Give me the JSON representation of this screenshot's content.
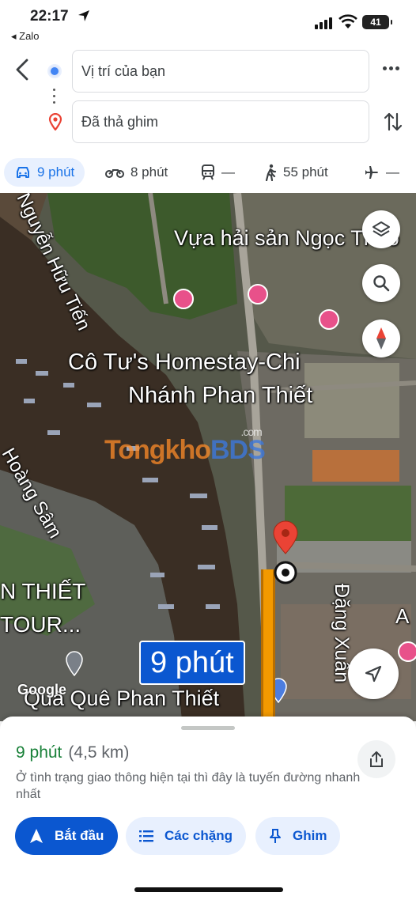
{
  "status_bar": {
    "time": "22:17",
    "back_app": "◂ Zalo",
    "battery": "41"
  },
  "route": {
    "origin_label": "Vị trí của bạn",
    "destination_label": "Đã thả ghim"
  },
  "modes": [
    {
      "icon": "car-icon",
      "label": "9 phút",
      "active": true
    },
    {
      "icon": "motorbike-icon",
      "label": "8 phút"
    },
    {
      "icon": "transit-icon",
      "label": "—"
    },
    {
      "icon": "walk-icon",
      "label": "55 phút"
    },
    {
      "icon": "flight-icon",
      "label": "—"
    }
  ],
  "map": {
    "labels": {
      "street_1": "Nguyễn Hữu Tiến",
      "poi_1": "Vựa hải sản Ngọc Thảo",
      "poi_2_line1": "Cô Tư's Homestay-Chi",
      "poi_2_line2": "Nhánh Phan Thiết",
      "street_2": "Hoàng Sâm",
      "poi_3_line1": "N THIẾT",
      "poi_3_line2": "TOUR...",
      "poi_4": "Quà Quê Phan Thiết",
      "street_3": "Đặng Xuân",
      "edge": "A"
    },
    "time_badge": "9 phút",
    "watermark": {
      "main": "Tongkho",
      "accent": "BDS",
      "suffix": ".com"
    },
    "logo": "Google",
    "colors": {
      "route": "#f29900",
      "pin": "#ea4335",
      "badge": "#0b57d0"
    }
  },
  "sheet": {
    "eta": "9 phút",
    "distance": "(4,5 km)",
    "description": "Ở tình trạng giao thông hiện tại thì đây là tuyến đường nhanh nhất",
    "buttons": {
      "start": "Bắt đầu",
      "steps": "Các chặng",
      "pin": "Ghim"
    }
  }
}
